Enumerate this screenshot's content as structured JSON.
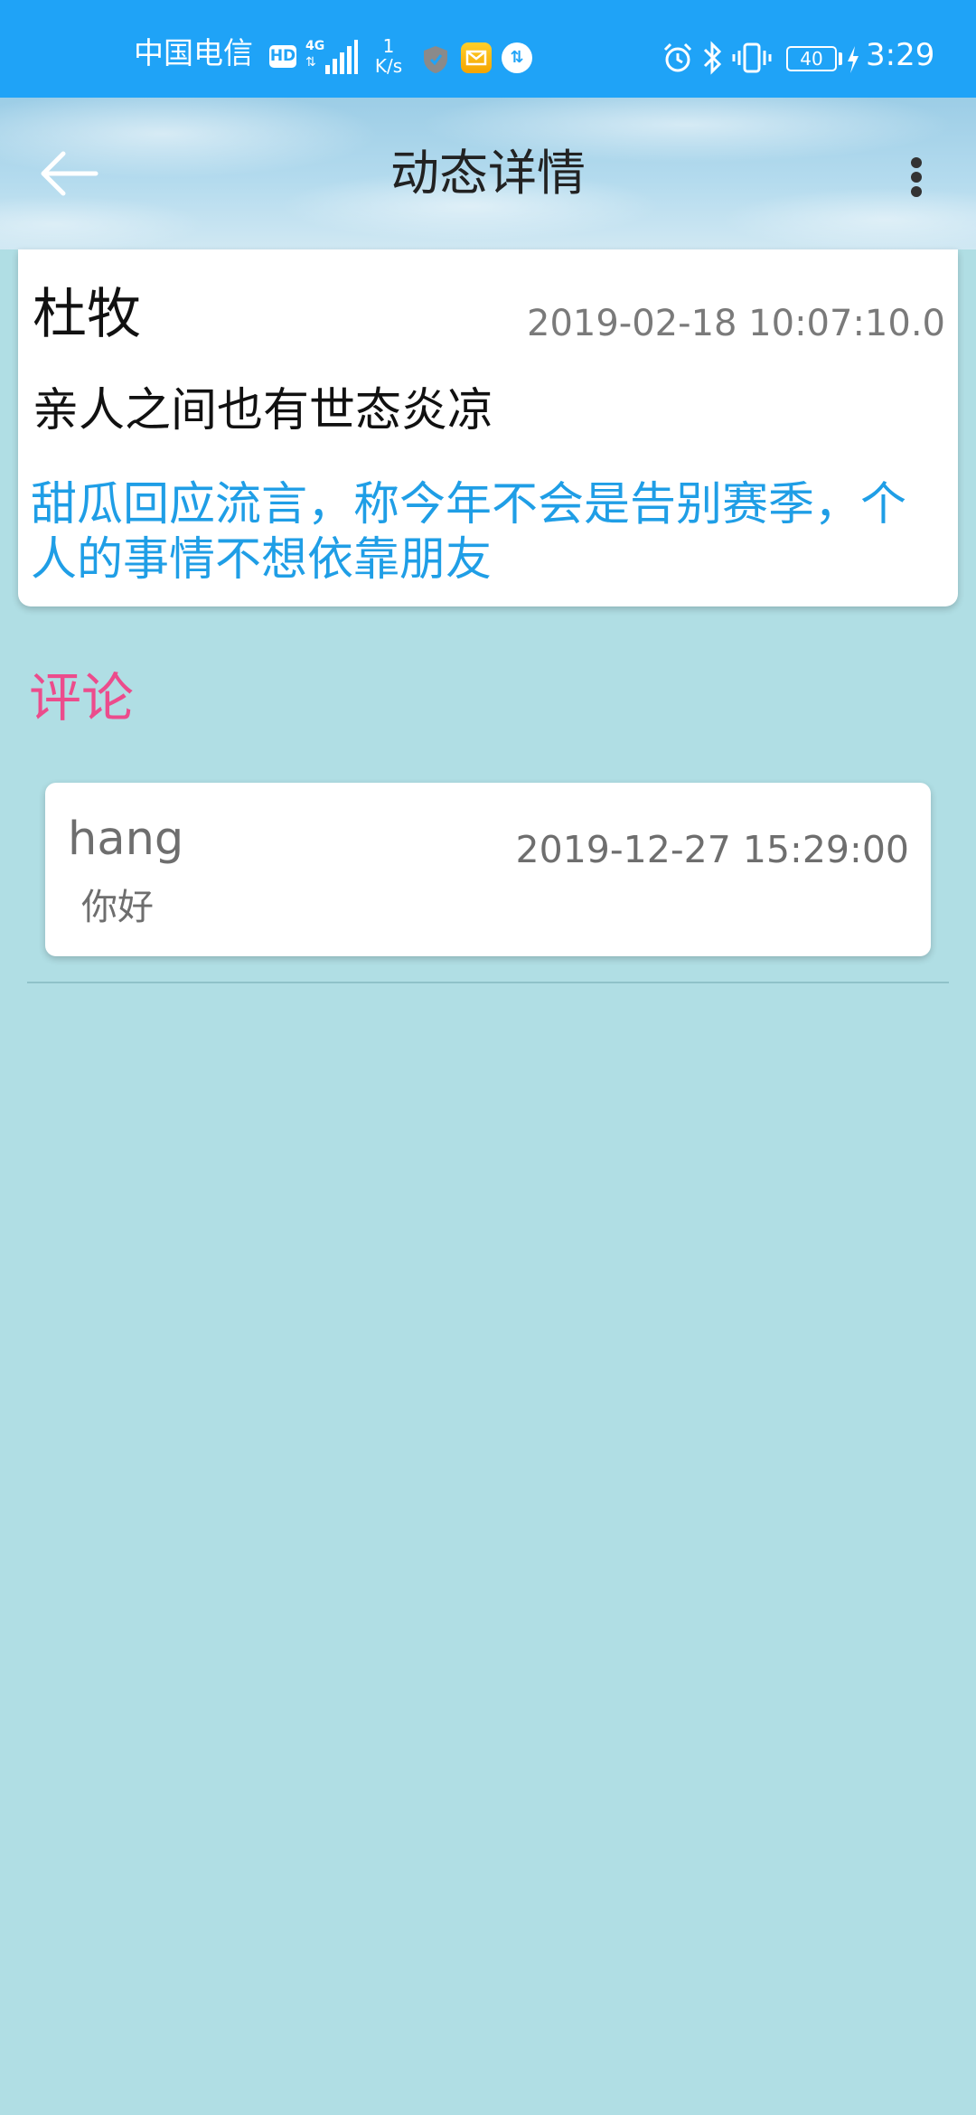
{
  "status_bar": {
    "carrier": "中国电信",
    "hd_badge": "HD",
    "network_type": "4G",
    "speed_value": "1",
    "speed_unit": "K/s",
    "battery_level": "40",
    "time": "3:29",
    "icons": [
      "hd-icon",
      "signal-4g-icon",
      "shield-icon",
      "mail-icon",
      "sync-icon",
      "alarm-icon",
      "bluetooth-icon",
      "vibrate-icon",
      "battery-icon",
      "charging-icon"
    ]
  },
  "toolbar": {
    "title": "动态详情",
    "back_icon": "arrow-left-icon",
    "more_icon": "more-vertical-icon"
  },
  "post": {
    "author": "杜牧",
    "time": "2019-02-18 10:07:10.0",
    "title": "亲人之间也有世态炎凉",
    "body": "甜瓜回应流言，称今年不会是告别赛季，个人的事情不想依靠朋友"
  },
  "comments": {
    "heading": "评论",
    "items": [
      {
        "user": "hang",
        "time": "2019-12-27 15:29:00",
        "text": "你好"
      }
    ]
  },
  "colors": {
    "status_bar": "#1fa3f7",
    "page_background": "#b0dee4",
    "post_body_text": "#1f9ee6",
    "comments_heading": "#ec4c8c",
    "secondary_text": "#7a7a7a"
  }
}
